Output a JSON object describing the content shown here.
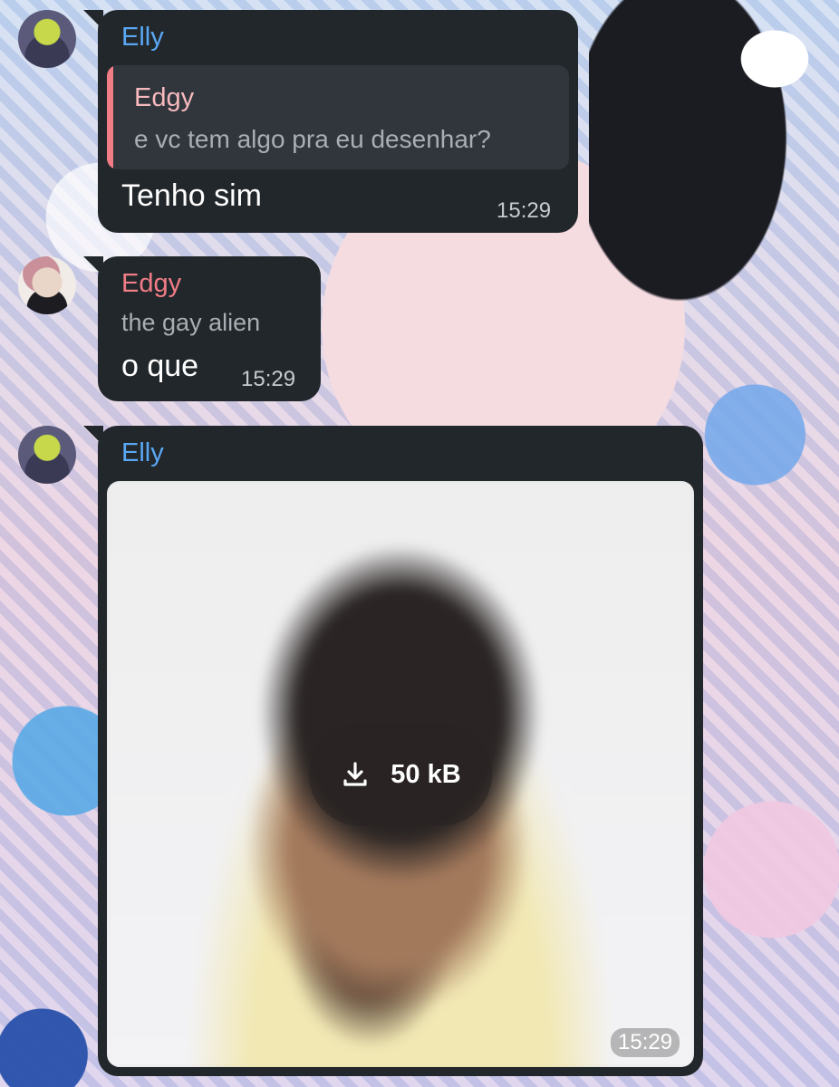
{
  "messages": [
    {
      "sender": "Elly",
      "reply": {
        "sender": "Edgy",
        "text": "e vc tem algo pra eu desenhar?"
      },
      "text": "Tenho sim",
      "time": "15:29"
    },
    {
      "sender": "Edgy",
      "subtitle": "the gay alien",
      "text": "o que",
      "time": "15:29"
    },
    {
      "sender": "Elly",
      "photo": {
        "download_label": "50 kB",
        "time": "15:29"
      }
    }
  ],
  "colors": {
    "bubble": "#22272b",
    "elly_name": "#5aa8f5",
    "edgy_name": "#f07c86",
    "reply_bar": "#f07c86",
    "reply_name": "#f6b9be"
  },
  "icons": [
    "download-icon"
  ]
}
